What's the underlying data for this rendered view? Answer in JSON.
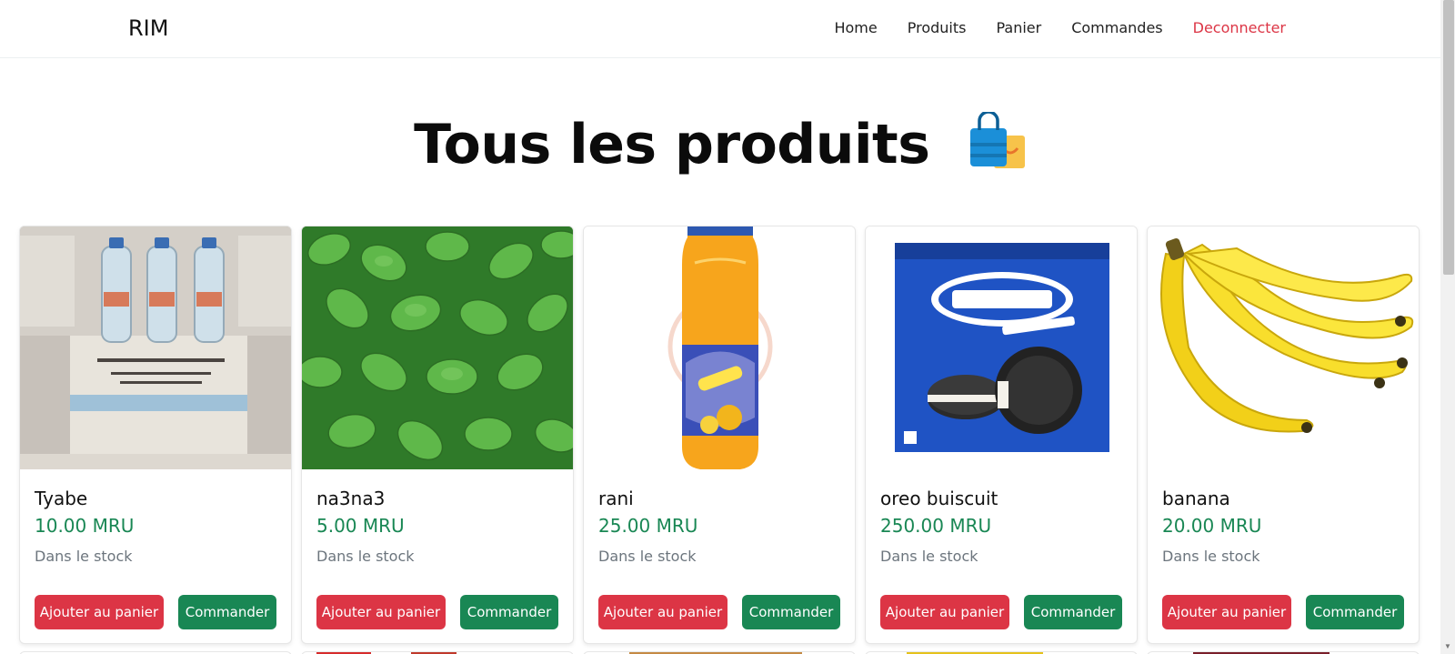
{
  "nav": {
    "brand": "RIM",
    "links": [
      "Home",
      "Produits",
      "Panier",
      "Commandes",
      "Deconnecter"
    ]
  },
  "page": {
    "title": "Tous les produits"
  },
  "products": [
    {
      "name": "Tyabe",
      "price": "10.00 MRU",
      "stock": "Dans le stock",
      "image": "water-bottles-image"
    },
    {
      "name": "na3na3",
      "price": "5.00 MRU",
      "stock": "Dans le stock",
      "image": "mint-leaves-image"
    },
    {
      "name": "rani",
      "price": "25.00 MRU",
      "stock": "Dans le stock",
      "image": "juice-bottle-image"
    },
    {
      "name": "oreo buiscuit",
      "price": "250.00 MRU",
      "stock": "Dans le stock",
      "image": "oreo-box-image"
    },
    {
      "name": "banana",
      "price": "20.00 MRU",
      "stock": "Dans le stock",
      "image": "banana-image"
    }
  ],
  "buttons": {
    "add_to_cart": "Ajouter au panier",
    "order": "Commander"
  },
  "colors": {
    "price": "#198754",
    "danger": "#dc3545",
    "success": "#198754"
  }
}
